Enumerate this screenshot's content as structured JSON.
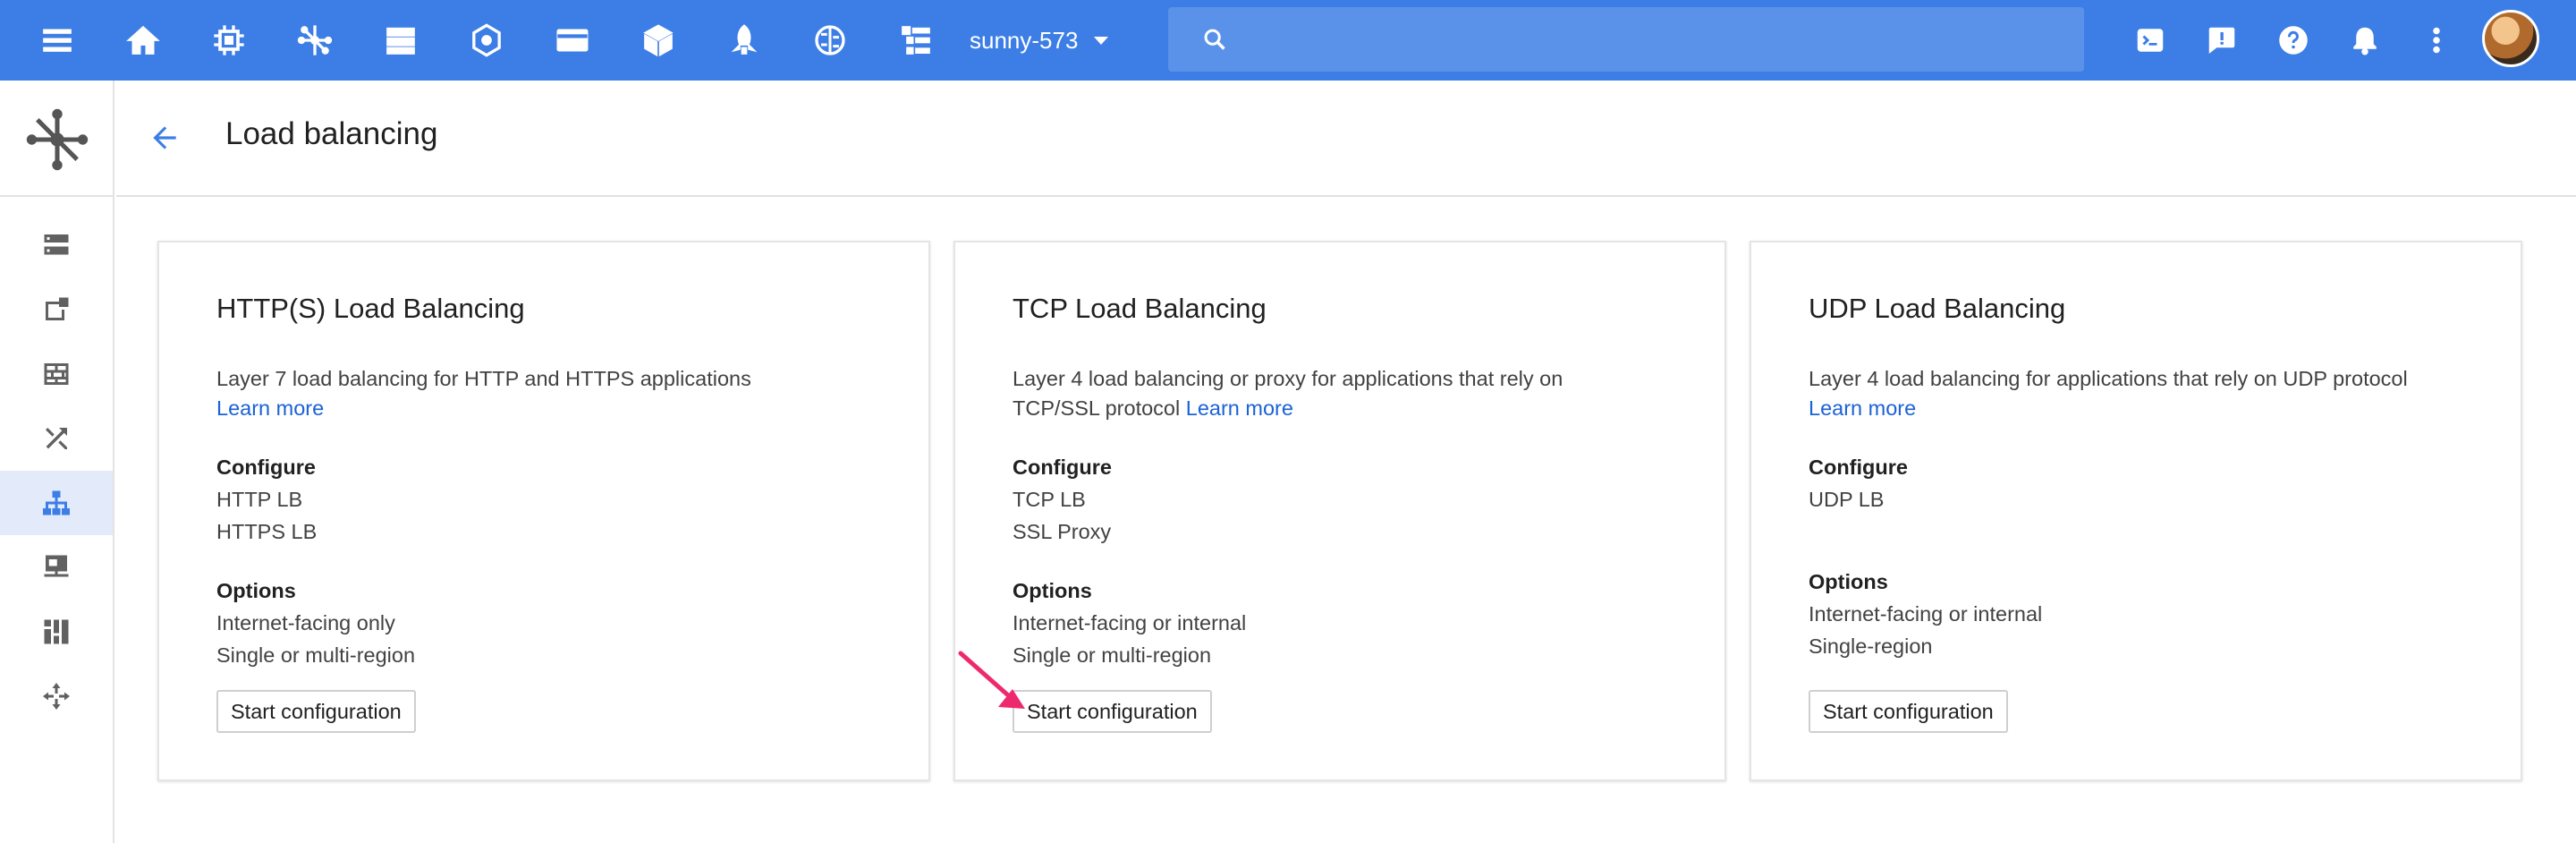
{
  "topbar": {
    "project": "sunny-573",
    "search_placeholder": "",
    "colors": {
      "bar": "#3d7ee6",
      "search": "#5a92ea"
    },
    "nav_icons": [
      "menu-icon",
      "home-icon",
      "chip-icon",
      "network-icon",
      "storage-icon",
      "hexagon-icon",
      "card-icon",
      "cube-icon",
      "rocket-icon",
      "brain-icon",
      "list-icon"
    ],
    "right_icons": [
      "cloud-shell-icon",
      "feedback-icon",
      "help-icon",
      "notifications-icon",
      "more-icon"
    ]
  },
  "rail": {
    "items": [
      "vpc-networks-icon",
      "external-ip-icon",
      "firewall-icon",
      "routes-icon",
      "load-balancing-icon",
      "vpn-icon",
      "cloud-dns-icon",
      "interconnect-icon"
    ],
    "active_index": 4
  },
  "header": {
    "title": "Load balancing"
  },
  "cards": [
    {
      "title": "HTTP(S) Load Balancing",
      "desc": "Layer 7 load balancing for HTTP and HTTPS applications",
      "learn_more": "Learn more",
      "configure_label": "Configure",
      "configure": [
        "HTTP LB",
        "HTTPS LB"
      ],
      "options_label": "Options",
      "options": [
        "Internet-facing only",
        "Single or multi-region"
      ],
      "button": "Start configuration"
    },
    {
      "title": "TCP Load Balancing",
      "desc": "Layer 4 load balancing or proxy for applications that rely on TCP/SSL protocol",
      "learn_more": "Learn more",
      "configure_label": "Configure",
      "configure": [
        "TCP LB",
        "SSL Proxy"
      ],
      "options_label": "Options",
      "options": [
        "Internet-facing or internal",
        "Single or multi-region"
      ],
      "button": "Start configuration"
    },
    {
      "title": "UDP Load Balancing",
      "desc": "Layer 4 load balancing for applications that rely on UDP protocol",
      "learn_more": "Learn more",
      "configure_label": "Configure",
      "configure": [
        "UDP LB"
      ],
      "options_label": "Options",
      "options": [
        "Internet-facing or internal",
        "Single-region"
      ],
      "button": "Start configuration"
    }
  ],
  "annotation": {
    "arrow_color": "#ee2a6e"
  }
}
